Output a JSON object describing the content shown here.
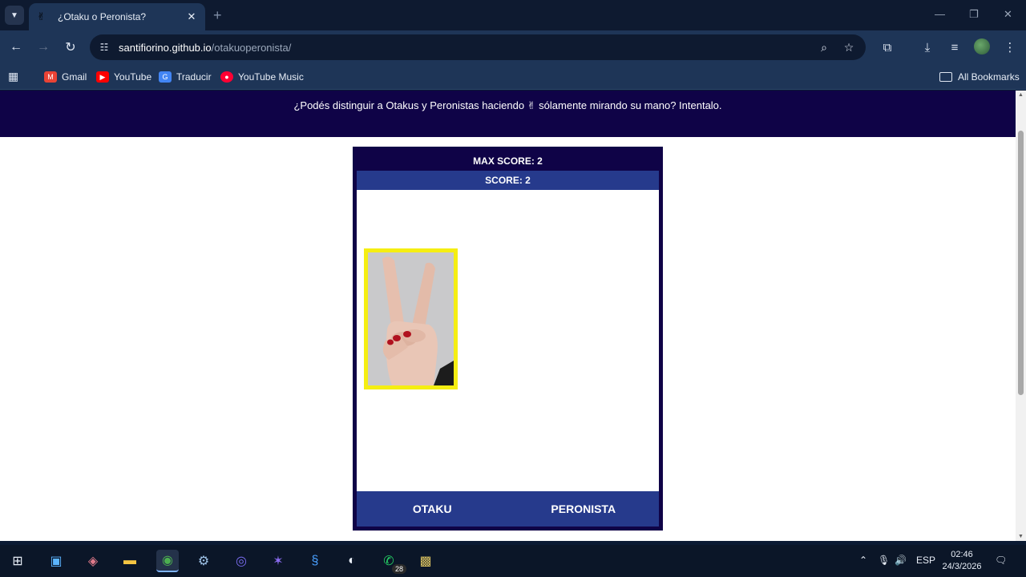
{
  "browser": {
    "tab_title": "¿Otaku o Peronista?",
    "tab_favicon": "✌",
    "url_domain": "santifiorino.github.io",
    "url_path": "/otakuoperonista/",
    "bookmarks": [
      {
        "label": "Gmail",
        "icon": "gmail-icon",
        "color": "#ea4335",
        "glyph": "M"
      },
      {
        "label": "YouTube",
        "icon": "youtube-icon",
        "color": "#ff0000",
        "glyph": "▶"
      },
      {
        "label": "Traducir",
        "icon": "translate-icon",
        "color": "#4285f4",
        "glyph": "G"
      },
      {
        "label": "YouTube Music",
        "icon": "youtube-music-icon",
        "color": "#ff0033",
        "glyph": "●"
      }
    ],
    "all_bookmarks_label": "All Bookmarks"
  },
  "page": {
    "banner_text": "¿Podés distinguir a Otakus y Peronistas haciendo ✌ sólamente mirando su mano? Intentalo.",
    "max_score_label": "MAX SCORE: 2",
    "score_label": "SCORE: 2",
    "buttons": {
      "otaku": "OTAKU",
      "peronista": "PERONISTA"
    },
    "colors": {
      "banner": "#0f0347",
      "score_bar": "#263a8c",
      "card_border": "#f5ee12"
    }
  },
  "taskbar": {
    "language": "ESP",
    "time": "02:46",
    "date": "24/3/2026",
    "whatsapp_badge": "28"
  }
}
